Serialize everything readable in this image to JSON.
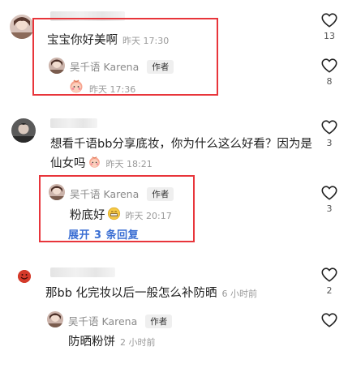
{
  "comments": [
    {
      "text": "宝宝你好美啊",
      "time": "昨天 17:30",
      "likes": "13",
      "reply": {
        "author": "吴千语 Karena",
        "author_tag": "作者",
        "text": "",
        "emoji": "peach-face-emoji",
        "time": "昨天 17:36",
        "likes": "8"
      }
    },
    {
      "text": "想看千语bb分享底妆，你为什么这么好看？因为是仙女吗",
      "emoji": "peach-face-emoji",
      "time": "昨天 18:21",
      "likes": "3",
      "reply": {
        "author": "吴千语 Karena",
        "author_tag": "作者",
        "text": "粉底好",
        "emoji": "grin-emoji",
        "time": "昨天 20:17",
        "likes": "3"
      },
      "expand_label": "展开 3 条回复"
    },
    {
      "text": "那bb 化完妆以后一般怎么补防晒",
      "time": "6 小时前",
      "likes": "2",
      "reply": {
        "author": "吴千语 Karena",
        "author_tag": "作者",
        "text": "防晒粉饼",
        "time": "2 小时前",
        "likes": ""
      }
    }
  ],
  "colors": {
    "highlight": "#e8353b",
    "expand_link": "#3a6ed3",
    "meta_gray": "#9a9a9a"
  }
}
